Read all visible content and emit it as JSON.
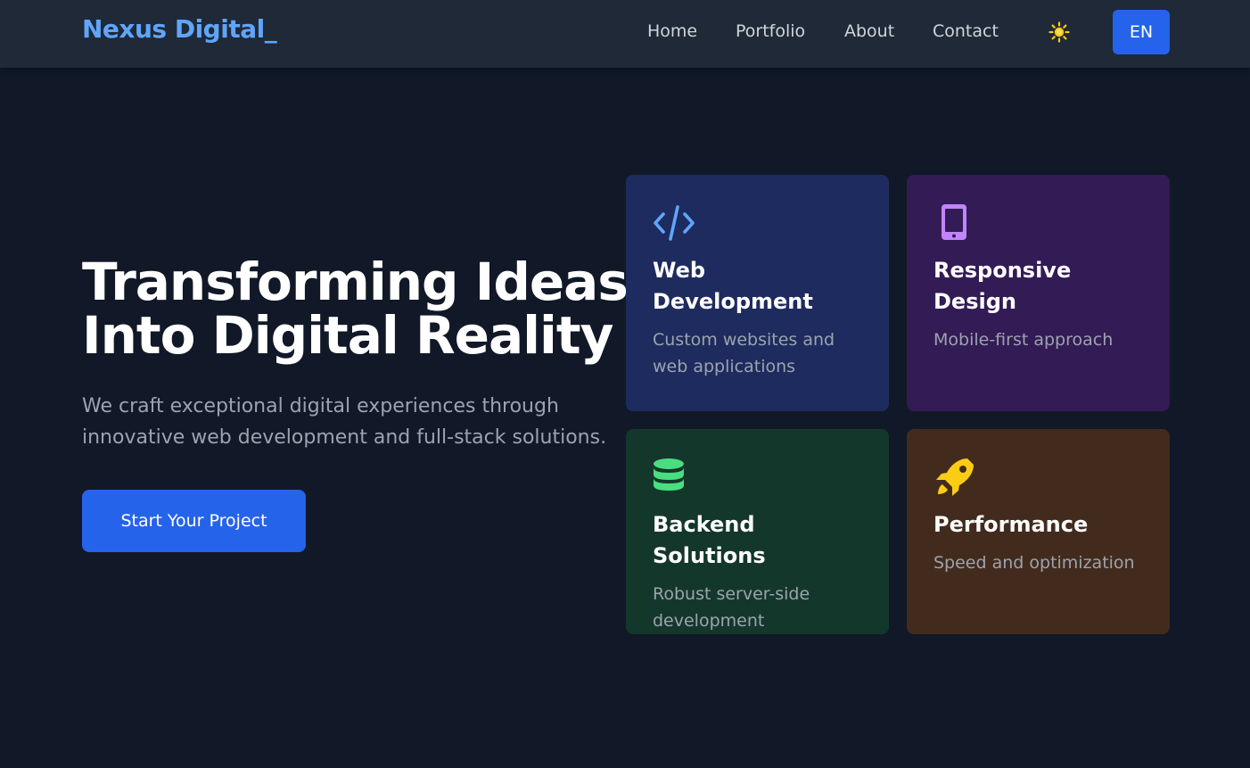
{
  "nav": {
    "logo": "Nexus Digital_",
    "links": [
      "Home",
      "Portfolio",
      "About",
      "Contact"
    ],
    "theme_icon": "sun-icon",
    "language": "EN"
  },
  "hero": {
    "title_line1": "Transforming Ideas",
    "title_line2": "Into Digital Reality",
    "subtitle": "We craft exceptional digital experiences through innovative web development and full-stack solutions.",
    "cta": "Start Your Project"
  },
  "cards": [
    {
      "icon": "code-icon",
      "title": "Web Development",
      "description": "Custom websites and web applications",
      "color": "#60a5fa"
    },
    {
      "icon": "mobile-icon",
      "title": "Responsive Design",
      "description": "Mobile-first approach",
      "color": "#c084fc"
    },
    {
      "icon": "database-icon",
      "title": "Backend Solutions",
      "description": "Robust server-side development",
      "color": "#4ade80"
    },
    {
      "icon": "rocket-icon",
      "title": "Performance",
      "description": "Speed and optimization",
      "color": "#facc15"
    }
  ],
  "colors": {
    "background": "#111827",
    "navbar": "#1f2937",
    "accent": "#2563eb",
    "logo": "#60a5fa"
  }
}
